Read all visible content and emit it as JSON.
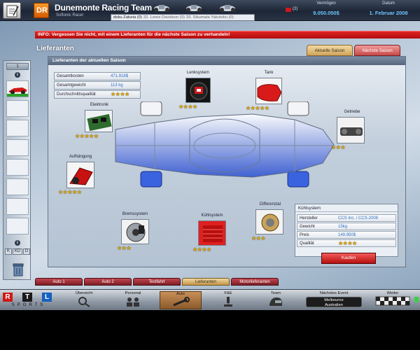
{
  "topbar": {
    "team_name": "Dunemonte Racing Team",
    "team_subtitle": "Softonic Racer",
    "drivers": [
      "doku Zaturia (0)",
      "32. Lewis Davidson (0)",
      "33. Sikumata Yakutoku (0)"
    ],
    "mail_count": "(2)",
    "money_label": "Vermögen",
    "money_value": "9.050.050$",
    "date_label": "Datum",
    "date_value": "1. Februar 2008"
  },
  "info_message": "INFO: Vergessen Sie nicht, mit einem Lieferanten für die nächste Saison zu verhandeln!",
  "section": {
    "title": "Lieferanten",
    "tab_current": "Aktuelle Saison",
    "tab_next": "Nächste Saison",
    "panel_header": "Lieferanten der aktuellen Saison"
  },
  "summary": {
    "cost_label": "Gesamtkosten",
    "cost_value": "471.918$",
    "weight_label": "Gesamtgewicht",
    "weight_value": "113 kg",
    "quality_label": "Durchschnittsqualität",
    "quality_stars": 4
  },
  "parts": [
    {
      "name": "Elektronik",
      "stars": 5
    },
    {
      "name": "Lenksystem",
      "stars": 4
    },
    {
      "name": "Tank",
      "stars": 5
    },
    {
      "name": "Getriebe",
      "stars": 3
    },
    {
      "name": "Aufhängung",
      "stars": 5
    },
    {
      "name": "Bremssystem",
      "stars": 3
    },
    {
      "name": "Kühlsystem",
      "stars": 4
    },
    {
      "name": "Differenzial",
      "stars": 3
    }
  ],
  "detail": {
    "title": "Kühlsystem",
    "manufacturer_label": "Hersteller",
    "manufacturer_value": "CCS Inc. / CCS-2008",
    "weight_label": "Gewicht",
    "weight_value": "15kg",
    "price_label": "Preis",
    "price_value": "149.950$",
    "quality_label": "Qualität",
    "quality_stars": 4,
    "buy_label": "Kaufen"
  },
  "lower_tabs": [
    "Auto 1",
    "Auto 2",
    "Testfahrt",
    "Lieferanten",
    "Motorlieferanten"
  ],
  "left_panel": {
    "counter": "1",
    "nav": [
      "K",
      "KD",
      "D"
    ]
  },
  "bottom_nav": {
    "rtl_letters": [
      "R",
      "T",
      "L"
    ],
    "sports": "SPORTS",
    "items": [
      "Übersicht",
      "Personal",
      "Auto",
      "F&E",
      "Team"
    ],
    "event_label": "Nächstes Event",
    "event_value_1": "Melbourne",
    "event_value_2": "Australien",
    "weiter_label": "Weiter"
  },
  "colors": {
    "accent_red": "#d01818",
    "value_blue": "#2f6dc2",
    "star_gold": "#e0a800"
  }
}
